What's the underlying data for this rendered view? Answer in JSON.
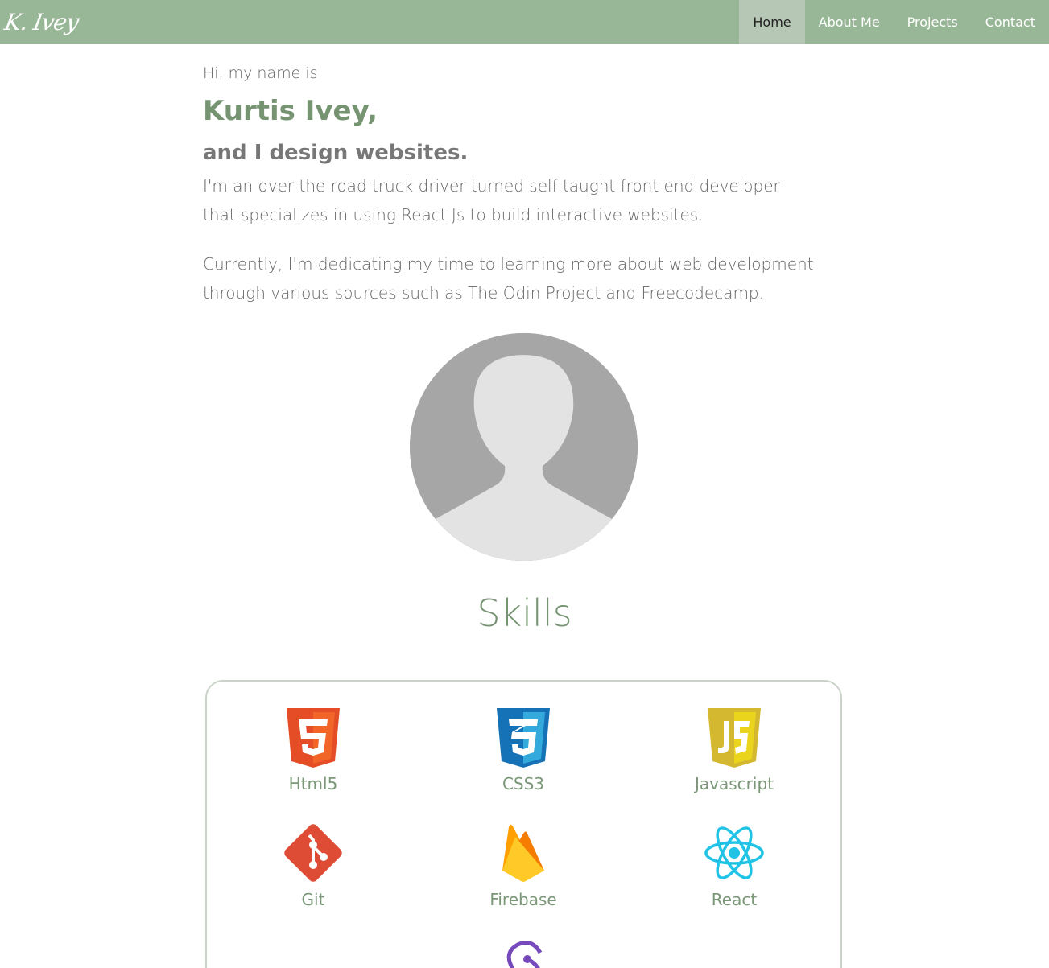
{
  "nav": {
    "logo": "K. Ivey",
    "links": [
      "Home",
      "About Me",
      "Projects",
      "Contact"
    ],
    "active": "Home"
  },
  "hero": {
    "intro": "Hi, my name is",
    "name": "Kurtis Ivey,",
    "tagline": "and I design websites.",
    "bio1": "I'm an over the road truck driver turned self taught front end developer that specializes in using React Js to build interactive websites.",
    "bio2": "Currently, I'm dedicating my time to learning more about web development through various sources such as The Odin Project and Freecodecamp."
  },
  "skills": {
    "title": "Skills",
    "items": [
      {
        "label": "Html5",
        "icon": "html5-icon"
      },
      {
        "label": "CSS3",
        "icon": "css3-icon"
      },
      {
        "label": "Javascript",
        "icon": "javascript-icon"
      },
      {
        "label": "Git",
        "icon": "git-icon"
      },
      {
        "label": "Firebase",
        "icon": "firebase-icon"
      },
      {
        "label": "React",
        "icon": "react-icon"
      },
      {
        "label": "",
        "icon": "redux-icon"
      }
    ]
  },
  "colors": {
    "navbar": "#98b796",
    "accent": "#769472",
    "active_tab": "#b7c7b5"
  }
}
